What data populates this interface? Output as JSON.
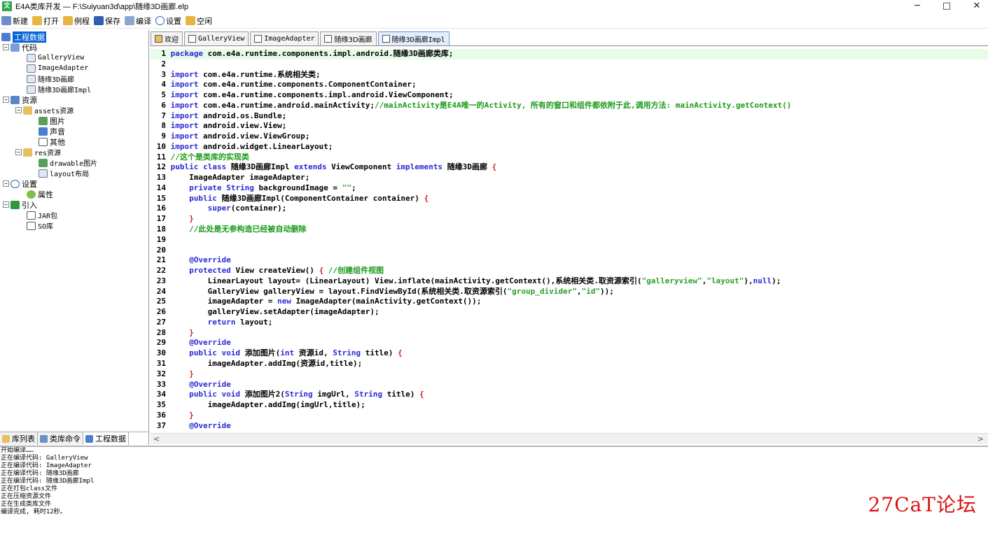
{
  "window": {
    "title": "E4A类库开发 — F:\\Suiyuan3d\\app\\随缘3D画廊.elp",
    "minimize": "─",
    "maximize": "□",
    "close": "✕"
  },
  "toolbar": {
    "new_label": "新建",
    "open_label": "打开",
    "example_label": "例程",
    "save_label": "保存",
    "compile_label": "编译",
    "settings_label": "设置",
    "empty_label": "空闲"
  },
  "tree": {
    "root": "工程数据",
    "code": "代码",
    "code_items": [
      "GalleryView",
      "ImageAdapter",
      "随缘3D画廊",
      "随缘3D画廊Impl"
    ],
    "resources": "资源",
    "assets": "assets资源",
    "assets_items": [
      "图片",
      "声音",
      "其他"
    ],
    "res": "res资源",
    "res_items": [
      "drawable图片",
      "layout布局"
    ],
    "settings": "设置",
    "settings_items": [
      "属性"
    ],
    "imports": "引入",
    "imports_items": [
      "JAR包",
      "SO库"
    ]
  },
  "left_tabs": [
    "库列表",
    "类库命令",
    "工程数据"
  ],
  "editor_tabs": [
    "欢迎",
    "GalleryView",
    "ImageAdapter",
    "随缘3D画廊",
    "随缘3D画廊Impl"
  ],
  "code": [
    "1",
    "2",
    "3",
    "4",
    "5",
    "6",
    "7",
    "8",
    "9",
    "10",
    "11",
    "12",
    "13",
    "14",
    "15",
    "16",
    "17",
    "18",
    "19",
    "20",
    "21",
    "22",
    "23",
    "24",
    "25",
    "26",
    "27",
    "28",
    "29",
    "30",
    "31",
    "32",
    "33",
    "34",
    "35",
    "36",
    "37"
  ],
  "code_text": {
    "l1a": "package",
    "l1b": " com.e4a.runtime.components.impl.android.随缘3D画廊类库;",
    "imp": "import",
    "l3": " com.e4a.runtime.系统相关类;",
    "l4": " com.e4a.runtime.components.ComponentContainer;",
    "l5": " com.e4a.runtime.components.impl.android.ViewComponent;",
    "l6": " com.e4a.runtime.android.mainActivity;",
    "l6c": "//mainActivity是E4A唯一的Activity, 所有的窗口和组件都依附于此,调用方法: mainActivity.getContext()",
    "l7": " android.os.Bundle;",
    "l8": " android.view.View;",
    "l9": " android.view.ViewGroup;",
    "l10": " android.widget.LinearLayout;",
    "l11": "//这个是类库的实现类",
    "l12a": "public class",
    "l12b": " 随缘3D画廊Impl ",
    "l12c": "extends",
    "l12d": " ViewComponent ",
    "l12e": "implements",
    "l12f": " 随缘3D画廊 ",
    "l12g": "{",
    "l13": "    ImageAdapter imageAdapter;",
    "l14a": "    private",
    "l14b": " String",
    "l14c": " backgroundImage = ",
    "l14d": "\"\"",
    "l14e": ";",
    "l15a": "    public",
    "l15b": " 随缘3D画廊Impl(ComponentContainer container) ",
    "l15c": "{",
    "l16a": "        super",
    "l16b": "(container);",
    "l17": "    }",
    "l18": "    //此处是无参构造已经被自动删除",
    "override": "@Override",
    "l22a": "    protected",
    "l22b": " View createView() ",
    "l22c": "{",
    "l22d": " //创建组件视图",
    "l23a": "        LinearLayout layout= (LinearLayout) View.inflate(mainActivity.getContext(),系统相关类.取资源索引(",
    "l23b": "\"galleryview\"",
    "l23c": ",",
    "l23d": "\"layout\"",
    "l23e": "),",
    "l23f": "null",
    "l23g": ");",
    "l24a": "        GalleryView galleryView = layout.FindViewById(系统相关类.取资源索引(",
    "l24b": "\"group_divider\"",
    "l24c": ",",
    "l24d": "\"id\"",
    "l24e": "));",
    "l25a": "        imageAdapter = ",
    "l25b": "new",
    "l25c": " ImageAdapter(mainActivity.getContext());",
    "l26": "        galleryView.setAdapter(imageAdapter);",
    "l27a": "        return",
    "l27b": " layout;",
    "l30a": "    public void",
    "l30b": " 添加图片(",
    "l30c": "int",
    "l30d": " 资源id, ",
    "l30e": "String",
    "l30f": " title) ",
    "l30g": "{",
    "l31": "        imageAdapter.addImg(资源id,title);",
    "l34a": "    public void",
    "l34b": " 添加图片2(",
    "l34c": "String",
    "l34d": " imgUrl, ",
    "l34e": "String",
    "l34f": " title) ",
    "l34g": "{",
    "l35": "        imageAdapter.addImg(imgUrl,title);"
  },
  "output_lines": [
    "开始编译……",
    "正在编译代码: GalleryView",
    "正在编译代码: ImageAdapter",
    "正在编译代码: 随缘3D画廊",
    "正在编译代码: 随缘3D画廊Impl",
    "正在打包class文件",
    "正在压缩资源文件",
    "正在生成类库文件",
    "编译完成, 耗时12秒。"
  ],
  "watermark": "27CaT论坛",
  "scroll": {
    "left": "<",
    "right": ">"
  }
}
